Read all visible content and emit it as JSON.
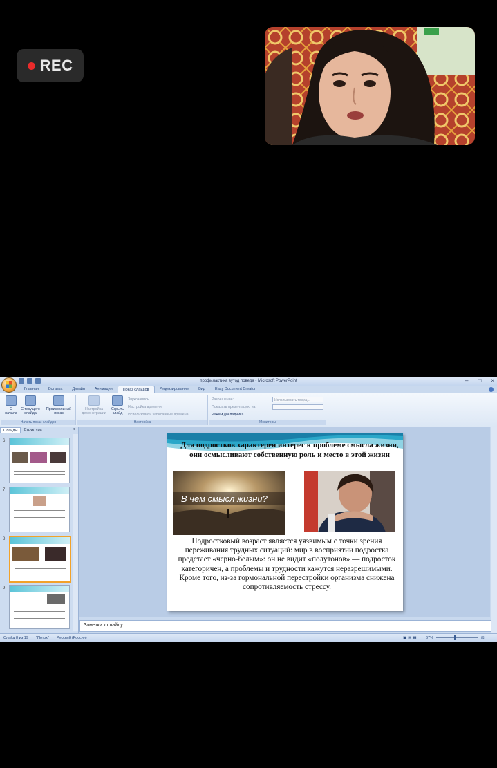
{
  "recording": {
    "label": "REC"
  },
  "app": {
    "window_title": "профилактика вутод поведа - Microsoft PowerPoint",
    "tabs": [
      "Главная",
      "Вставка",
      "Дизайн",
      "Анимация",
      "Показ слайдов",
      "Рецензирование",
      "Вид",
      "Easy Document Creator"
    ],
    "active_tab": "Показ слайдов",
    "ribbon": {
      "group1": {
        "caption": "Начать показ слайдов",
        "buttons": [
          "С начала",
          "С текущего слайда",
          "Произвольный показ"
        ]
      },
      "group2": {
        "caption": "Настройка",
        "buttons": [
          "Настройка демонстрации",
          "Скрыть слайд"
        ],
        "small": [
          "Звукозапись",
          "Настройка времени",
          "Использовать записанные времена"
        ]
      },
      "group3": {
        "caption": "Мониторы",
        "small": [
          "Разрешение:",
          "Показать презентацию на:",
          "Режим докладчика"
        ],
        "resolution_value": "Использовать текущ..."
      }
    },
    "left_pane": {
      "tabs": [
        "Слайды",
        "Структура"
      ],
      "close": "x",
      "slide_numbers": [
        "6",
        "7",
        "8",
        "9"
      ]
    },
    "slide": {
      "title": "Для подростков характерен интерес к проблеме смысла жизни, они осмысливают собственную роль и место в этой жизни",
      "image_caption": "В чем смысл жизни?",
      "body": "Подростковый возраст является уязвимым с точки зрения переживания трудных ситуаций: мир в восприятии подростка предстает «черно-белым»: он не видит «полутонов» — подросток категоричен, а проблемы и трудности кажутся неразрешимыми. Кроме того, из-за гормональной перестройки организма снижена сопротивляемость стрессу."
    },
    "notes_placeholder": "Заметки к слайду",
    "status": {
      "slide_counter": "Слайд 8 из 19",
      "theme": "\"Поток\"",
      "language": "Русский (Россия)",
      "zoom": "67%"
    }
  }
}
